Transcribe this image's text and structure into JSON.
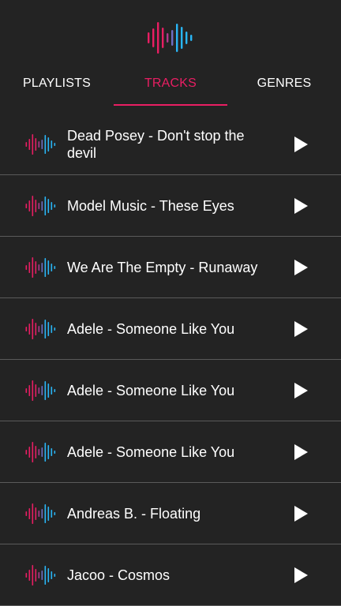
{
  "app": {
    "logo_icon": "waveform-logo-icon",
    "accent_color": "#e91e63",
    "wave_colors": [
      "#e91e63",
      "#9b59b6",
      "#29b6f6"
    ]
  },
  "tabs": [
    {
      "label": "PLAYLISTS",
      "selected": false
    },
    {
      "label": "TRACKS",
      "selected": true
    },
    {
      "label": "GENRES",
      "selected": false
    }
  ],
  "tracks": [
    {
      "title": "Dead Posey - Don't stop the devil",
      "icon": "waveform-icon",
      "action_icon": "play-icon"
    },
    {
      "title": "Model Music - These Eyes",
      "icon": "waveform-icon",
      "action_icon": "play-icon"
    },
    {
      "title": "We Are The Empty - Runaway",
      "icon": "waveform-icon",
      "action_icon": "play-icon"
    },
    {
      "title": "Adele - Someone Like You",
      "icon": "waveform-icon",
      "action_icon": "play-icon"
    },
    {
      "title": "Adele - Someone Like You",
      "icon": "waveform-icon",
      "action_icon": "play-icon"
    },
    {
      "title": "Adele - Someone Like You",
      "icon": "waveform-icon",
      "action_icon": "play-icon"
    },
    {
      "title": "Andreas B. - Floating",
      "icon": "waveform-icon",
      "action_icon": "play-icon"
    },
    {
      "title": "Jacoo - Cosmos",
      "icon": "waveform-icon",
      "action_icon": "play-icon"
    }
  ]
}
